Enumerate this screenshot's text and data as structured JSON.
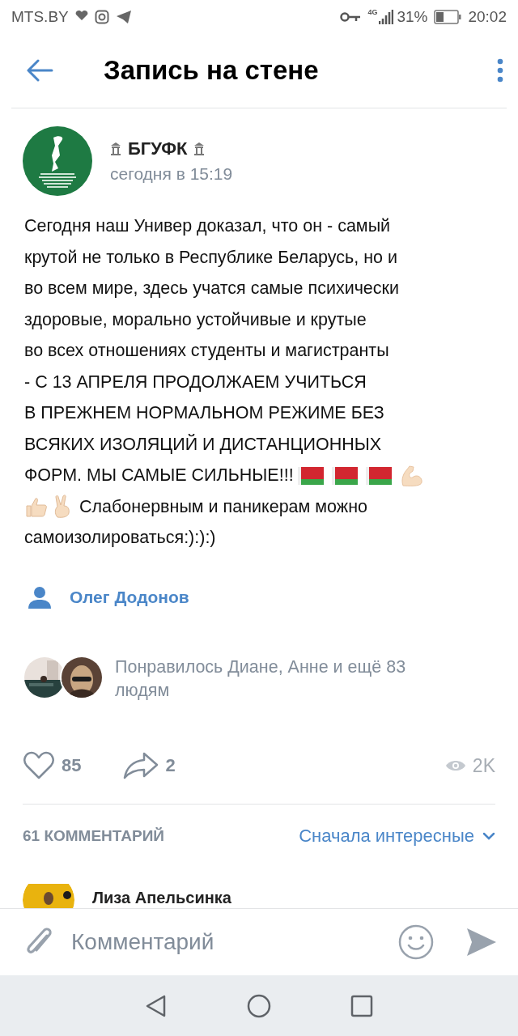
{
  "status_bar": {
    "carrier": "MTS.BY",
    "battery_percent": "31%",
    "time": "20:02",
    "network": "4G"
  },
  "header": {
    "title": "Запись на стене"
  },
  "post": {
    "author": "БГУФК",
    "time": "сегодня в 15:19",
    "body": [
      {
        "kind": "text",
        "text": "Сегодня наш Универ доказал, что он - самый\nкрутой не только в Республике Беларусь, но и\nво всем мире, здесь учатся самые психически\nздоровые, морально устойчивые и крутые\nво всех отношениях студенты и магистранты\n- С 13 АПРЕЛЯ ПРОДОЛЖАЕМ УЧИТЬСЯ\nВ ПРЕЖНЕМ НОРМАЛЬНОМ РЕЖИМЕ БЕЗ\nВСЯКИХ ИЗОЛЯЦИЙ И ДИСТАНЦИОННЫХ"
      },
      {
        "kind": "break"
      },
      {
        "kind": "text",
        "text": "ФОРМ. МЫ САМЫЕ СИЛЬНЫЕ!!!"
      },
      {
        "kind": "flag"
      },
      {
        "kind": "flag"
      },
      {
        "kind": "flag"
      },
      {
        "kind": "muscle"
      },
      {
        "kind": "break"
      },
      {
        "kind": "thumbs-up"
      },
      {
        "kind": "victory"
      },
      {
        "kind": "text",
        "text": "Слабонервным и паникерам можно"
      },
      {
        "kind": "break"
      },
      {
        "kind": "text",
        "text": "самоизолироваться:):):)"
      }
    ],
    "signer": "Олег Додонов",
    "liked_by": "Понравилось Диане, Анне и ещё 83 людям",
    "likes": "85",
    "reposts": "2",
    "views": "2K"
  },
  "comments": {
    "count_label": "61 КОММЕНТАРИЙ",
    "sort": "Сначала интересные",
    "items": [
      {
        "author": "Лиза Апельсинка"
      }
    ]
  },
  "composer": {
    "placeholder": "Комментарий"
  }
}
